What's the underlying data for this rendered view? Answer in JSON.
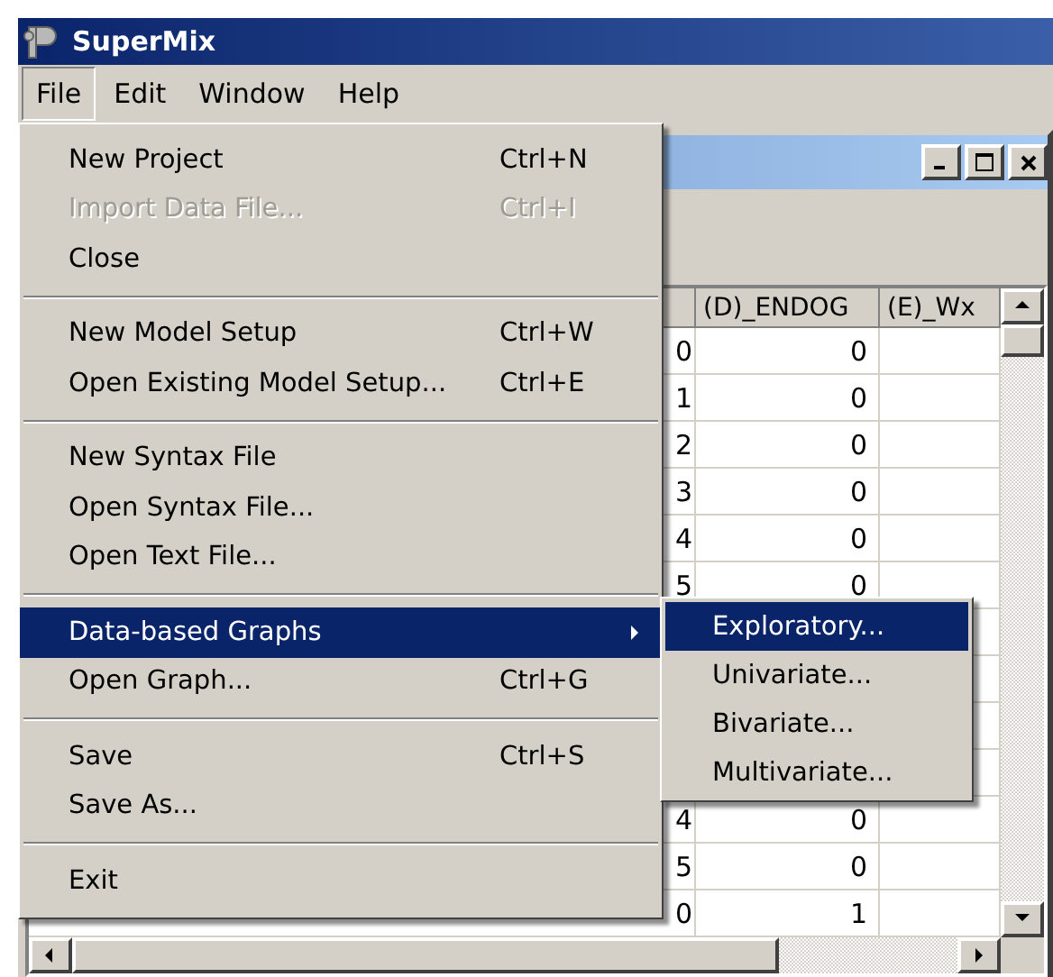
{
  "window": {
    "title": "SuperMix"
  },
  "menu_bar": [
    {
      "label": "File",
      "selected": true
    },
    {
      "label": "Edit",
      "selected": false
    },
    {
      "label": "Window",
      "selected": false
    },
    {
      "label": "Help",
      "selected": false
    }
  ],
  "file_menu": [
    {
      "kind": "item",
      "label": "New Project",
      "shortcut": "Ctrl+N",
      "disabled": false,
      "selected": false,
      "has_submenu": false
    },
    {
      "kind": "item",
      "label": "Import Data File...",
      "shortcut": "Ctrl+I",
      "disabled": true,
      "selected": false,
      "has_submenu": false
    },
    {
      "kind": "item",
      "label": "Close",
      "disabled": false,
      "selected": false,
      "has_submenu": false
    },
    {
      "kind": "separator"
    },
    {
      "kind": "item",
      "label": "New Model Setup",
      "shortcut": "Ctrl+W",
      "disabled": false,
      "selected": false,
      "has_submenu": false
    },
    {
      "kind": "item",
      "label": "Open Existing Model Setup...",
      "shortcut": "Ctrl+E",
      "disabled": false,
      "selected": false,
      "has_submenu": false
    },
    {
      "kind": "separator"
    },
    {
      "kind": "item",
      "label": "New Syntax File",
      "disabled": false,
      "selected": false,
      "has_submenu": false
    },
    {
      "kind": "item",
      "label": "Open Syntax File...",
      "disabled": false,
      "selected": false,
      "has_submenu": false
    },
    {
      "kind": "item",
      "label": "Open Text File...",
      "disabled": false,
      "selected": false,
      "has_submenu": false
    },
    {
      "kind": "separator"
    },
    {
      "kind": "item",
      "label": "Data-based Graphs",
      "disabled": false,
      "selected": true,
      "has_submenu": true
    },
    {
      "kind": "item",
      "label": "Open Graph...",
      "shortcut": "Ctrl+G",
      "disabled": false,
      "selected": false,
      "has_submenu": false
    },
    {
      "kind": "separator"
    },
    {
      "kind": "item",
      "label": "Save",
      "shortcut": "Ctrl+S",
      "disabled": false,
      "selected": false,
      "has_submenu": false
    },
    {
      "kind": "item",
      "label": "Save As...",
      "disabled": false,
      "selected": false,
      "has_submenu": false
    },
    {
      "kind": "separator"
    },
    {
      "kind": "item",
      "label": "Exit",
      "disabled": false,
      "selected": false,
      "has_submenu": false
    }
  ],
  "graphs_submenu": [
    {
      "label": "Exploratory...",
      "selected": true
    },
    {
      "label": "Univariate...",
      "selected": false
    },
    {
      "label": "Bivariate...",
      "selected": false
    },
    {
      "label": "Multivariate...",
      "selected": false
    }
  ],
  "table": {
    "columns": [
      "(D)_ENDOG",
      "(E)_Wx"
    ],
    "rows": [
      {
        "column_1": "0",
        "d_endog": "0"
      },
      {
        "column_1": "1",
        "d_endog": "0"
      },
      {
        "column_1": "2",
        "d_endog": "0"
      },
      {
        "column_1": "3",
        "d_endog": "0"
      },
      {
        "column_1": "4",
        "d_endog": "0"
      },
      {
        "column_1": "5",
        "d_endog": "0"
      },
      {},
      {},
      {},
      {},
      {
        "column_1": "4",
        "d_endog": "0"
      },
      {
        "column_1": "5",
        "d_endog": "0"
      },
      {
        "column_1": "0",
        "d_endog": "1"
      }
    ]
  }
}
